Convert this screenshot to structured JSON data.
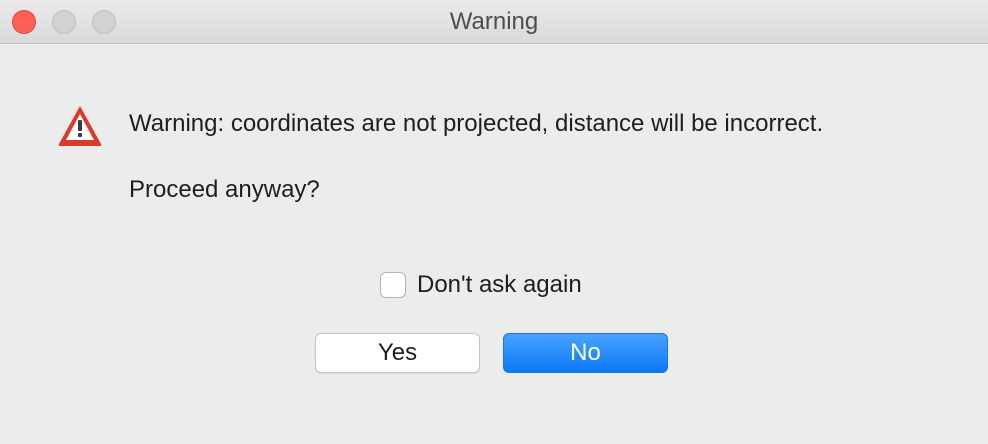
{
  "window": {
    "title": "Warning"
  },
  "dialog": {
    "icon": "warning-triangle-icon",
    "message": "Warning: coordinates are not projected, distance will be incorrect.",
    "question": "Proceed anyway?",
    "checkbox": {
      "label": "Don't ask again",
      "checked": false
    },
    "buttons": {
      "yes_label": "Yes",
      "no_label": "No",
      "default": "No"
    }
  },
  "colors": {
    "accent": "#0a78f5",
    "close_button": "#fe5f57",
    "warning": "#d93a2b"
  }
}
